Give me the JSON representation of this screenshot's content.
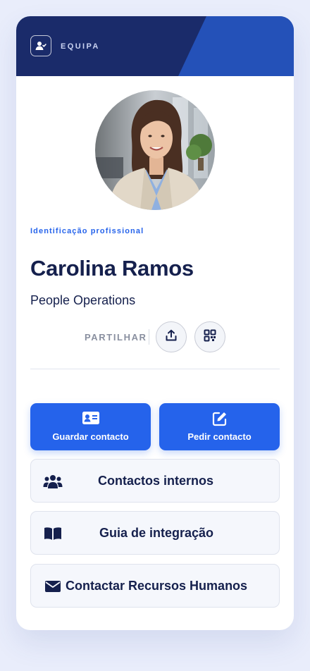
{
  "header": {
    "team_label": "EQUIPA",
    "icon": "team-user-icon",
    "colors": {
      "banner": "#1a2b6a",
      "accent_stripe": "#2451b8"
    }
  },
  "profile": {
    "photo_alt": "Carolina Ramos",
    "eyebrow": "Identificação profissional",
    "name": "Carolina Ramos",
    "role": "People Operations"
  },
  "share": {
    "label": "PARTILHAR",
    "buttons": [
      {
        "icon": "share-upload-icon"
      },
      {
        "icon": "qr-code-icon"
      }
    ]
  },
  "actions": {
    "primary": [
      {
        "label": "Guardar contacto",
        "icon": "contact-card-icon"
      },
      {
        "label": "Pedir contacto",
        "icon": "edit-icon"
      }
    ],
    "links": [
      {
        "label": "Contactos internos",
        "icon": "users-icon"
      },
      {
        "label": "Guia de integração",
        "icon": "book-icon"
      },
      {
        "label": "Contactar Recursos Humanos",
        "icon": "envelope-icon"
      }
    ]
  },
  "colors": {
    "page_bg": "#e9edfb",
    "primary": "#2563eb",
    "text_dark": "#15204d",
    "muted": "#8a90a0"
  }
}
